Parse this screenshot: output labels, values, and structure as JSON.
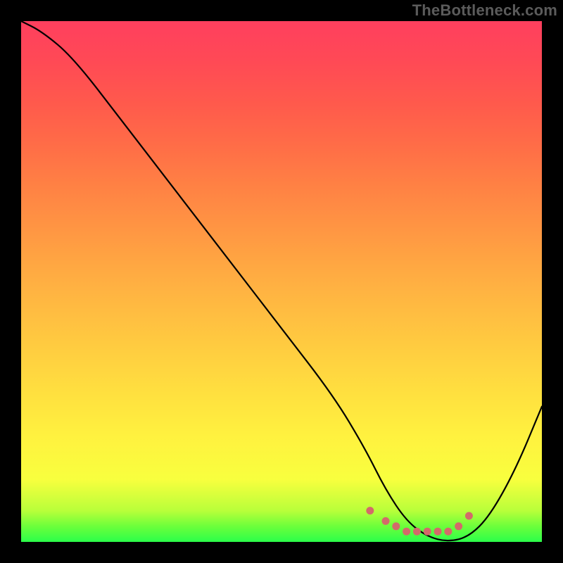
{
  "watermark": "TheBottleneck.com",
  "chart_data": {
    "type": "line",
    "title": "",
    "xlabel": "",
    "ylabel": "",
    "xlim": [
      0,
      100
    ],
    "ylim": [
      0,
      100
    ],
    "gradient_stops": [
      {
        "pct": 0,
        "color": "#2bff4a"
      },
      {
        "pct": 3,
        "color": "#6cff3b"
      },
      {
        "pct": 6,
        "color": "#b9ff3a"
      },
      {
        "pct": 12,
        "color": "#f8ff3e"
      },
      {
        "pct": 20,
        "color": "#fff23f"
      },
      {
        "pct": 28,
        "color": "#ffe13f"
      },
      {
        "pct": 36,
        "color": "#ffcf40"
      },
      {
        "pct": 44,
        "color": "#ffbd41"
      },
      {
        "pct": 52,
        "color": "#ffaa42"
      },
      {
        "pct": 60,
        "color": "#ff9643"
      },
      {
        "pct": 68,
        "color": "#ff8244"
      },
      {
        "pct": 76,
        "color": "#ff6d47"
      },
      {
        "pct": 84,
        "color": "#ff5a4c"
      },
      {
        "pct": 92,
        "color": "#ff4a55"
      },
      {
        "pct": 100,
        "color": "#ff3f5e"
      }
    ],
    "series": [
      {
        "name": "bottleneck-curve",
        "color": "#000000",
        "x": [
          0,
          4,
          10,
          20,
          30,
          40,
          50,
          60,
          66,
          70,
          74,
          78,
          82,
          86,
          90,
          95,
          100
        ],
        "values": [
          100,
          98,
          93,
          80,
          67,
          54,
          41,
          28,
          18,
          10,
          4,
          1,
          0,
          1,
          5,
          14,
          26
        ]
      }
    ],
    "markers": {
      "name": "valley-markers",
      "color": "#d36a6a",
      "x": [
        67,
        70,
        72,
        74,
        76,
        78,
        80,
        82,
        84,
        86
      ],
      "values": [
        6,
        4,
        3,
        2,
        2,
        2,
        2,
        2,
        3,
        5
      ]
    }
  }
}
